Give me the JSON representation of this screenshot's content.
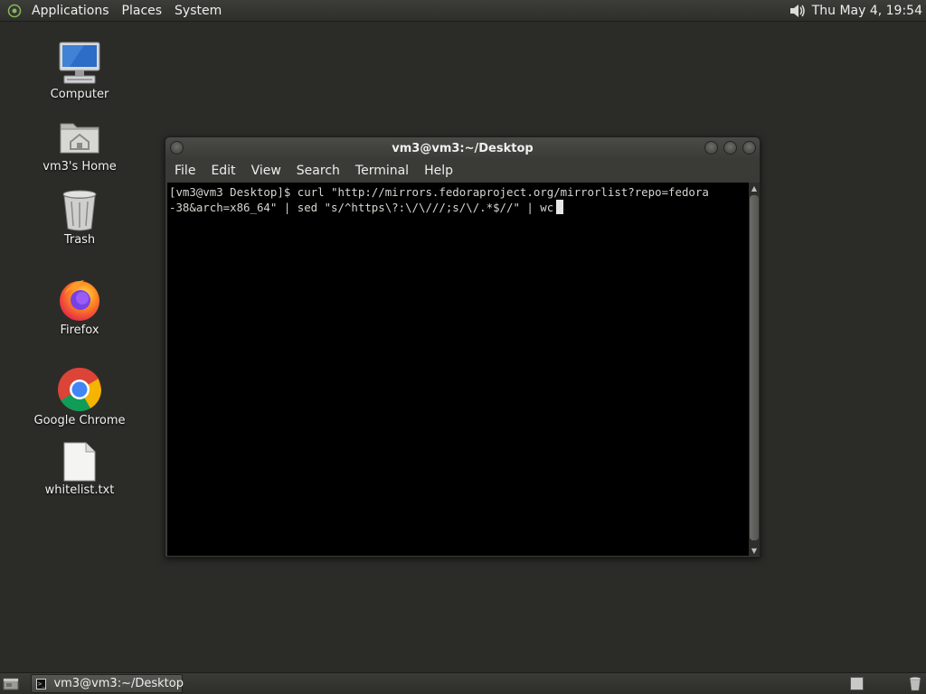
{
  "top_panel": {
    "menus": [
      "Applications",
      "Places",
      "System"
    ],
    "clock": "Thu May  4, 19:54",
    "volume_icon": "speaker-icon"
  },
  "desktop_icons": [
    {
      "label": "Computer",
      "icon": "computer-icon"
    },
    {
      "label": "vm3's Home",
      "icon": "home-folder-icon"
    },
    {
      "label": "Trash",
      "icon": "trash-icon"
    },
    {
      "label": "Firefox",
      "icon": "firefox-icon"
    },
    {
      "label": "Google Chrome",
      "icon": "chrome-icon"
    },
    {
      "label": "whitelist.txt",
      "icon": "text-file-icon"
    }
  ],
  "terminal": {
    "title": "vm3@vm3:~/Desktop",
    "menus": [
      "File",
      "Edit",
      "View",
      "Search",
      "Terminal",
      "Help"
    ],
    "lines": [
      "[vm3@vm3 Desktop]$ curl \"http://mirrors.fedoraproject.org/mirrorlist?repo=fedora",
      "-38&arch=x86_64\" | sed \"s/^https\\?:\\/\\///;s/\\/.*$//\" | wc"
    ]
  },
  "bottom_panel": {
    "task_label": "vm3@vm3:~/Desktop"
  },
  "colors": {
    "desktop_bg": "#2b2c28",
    "panel_bg": "#333430",
    "terminal_bg": "#000000",
    "terminal_fg": "#d3d7cf"
  }
}
